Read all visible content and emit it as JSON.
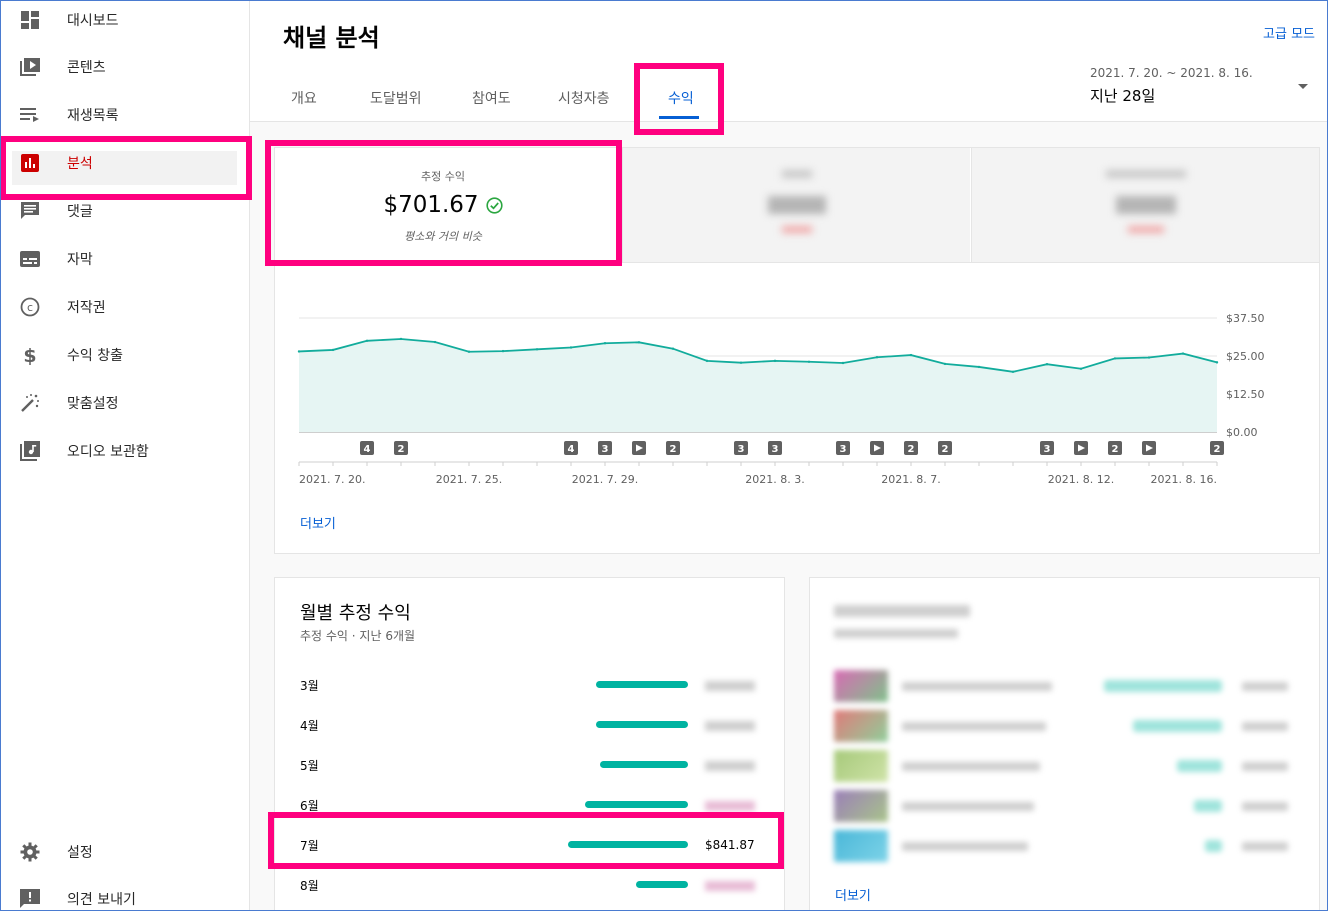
{
  "sidebar": {
    "items": [
      {
        "label": "대시보드",
        "icon": "dashboard-icon"
      },
      {
        "label": "콘텐츠",
        "icon": "content-icon"
      },
      {
        "label": "재생목록",
        "icon": "playlist-icon"
      },
      {
        "label": "분석",
        "icon": "analytics-icon"
      },
      {
        "label": "댓글",
        "icon": "comments-icon"
      },
      {
        "label": "자막",
        "icon": "subtitles-icon"
      },
      {
        "label": "저작권",
        "icon": "copyright-icon"
      },
      {
        "label": "수익 창출",
        "icon": "monetization-icon"
      },
      {
        "label": "맞춤설정",
        "icon": "customization-icon"
      },
      {
        "label": "오디오 보관함",
        "icon": "audio-library-icon"
      }
    ],
    "bottom": [
      {
        "label": "설정",
        "icon": "gear-icon"
      },
      {
        "label": "의견 보내기",
        "icon": "feedback-icon"
      }
    ]
  },
  "header": {
    "title": "채널 분석",
    "advanced_mode": "고급 모드",
    "tabs": [
      {
        "label": "개요"
      },
      {
        "label": "도달범위"
      },
      {
        "label": "참여도"
      },
      {
        "label": "시청자층"
      },
      {
        "label": "수익"
      }
    ],
    "active_tab": "수익",
    "date_range": "2021. 7. 20. ~ 2021. 8. 16.",
    "date_preset": "지난 28일"
  },
  "metric": {
    "label": "추정 수익",
    "value": "$701.67",
    "comparison": "평소와 거의 비슷"
  },
  "chart_data": {
    "type": "area",
    "x": [
      "2021. 7. 20.",
      "2021. 7. 21.",
      "2021. 7. 22.",
      "2021. 7. 23.",
      "2021. 7. 24.",
      "2021. 7. 25.",
      "2021. 7. 26.",
      "2021. 7. 27.",
      "2021. 7. 28.",
      "2021. 7. 29.",
      "2021. 7. 30.",
      "2021. 7. 31.",
      "2021. 8. 1.",
      "2021. 8. 2.",
      "2021. 8. 3.",
      "2021. 8. 4.",
      "2021. 8. 5.",
      "2021. 8. 6.",
      "2021. 8. 7.",
      "2021. 8. 8.",
      "2021. 8. 9.",
      "2021. 8. 10.",
      "2021. 8. 11.",
      "2021. 8. 12.",
      "2021. 8. 13.",
      "2021. 8. 14.",
      "2021. 8. 15.",
      "2021. 8. 16."
    ],
    "series": [
      {
        "values": [
          26.5,
          27.0,
          30.0,
          30.6,
          29.6,
          26.4,
          26.6,
          27.2,
          27.8,
          29.2,
          29.5,
          27.4,
          23.4,
          22.8,
          23.4,
          23.1,
          22.7,
          24.6,
          25.3,
          22.4,
          21.4,
          19.8,
          22.3,
          20.8,
          24.2,
          24.5,
          25.8,
          22.9
        ]
      }
    ],
    "y_ticks": [
      "$37.50",
      "$25.00",
      "$12.50",
      "$0.00"
    ],
    "ylim": [
      0,
      37.5
    ],
    "x_tick_labels": [
      {
        "i": 0,
        "label": "2021. 7. 20."
      },
      {
        "i": 5,
        "label": "2021. 7. 25."
      },
      {
        "i": 9,
        "label": "2021. 7. 29."
      },
      {
        "i": 14,
        "label": "2021. 8. 3."
      },
      {
        "i": 18,
        "label": "2021. 8. 7."
      },
      {
        "i": 23,
        "label": "2021. 8. 12."
      },
      {
        "i": 27,
        "label": "2021. 8. 16."
      }
    ],
    "markers": [
      {
        "i": 2,
        "text": "4"
      },
      {
        "i": 3,
        "text": "2"
      },
      {
        "i": 8,
        "text": "4"
      },
      {
        "i": 9,
        "text": "3"
      },
      {
        "i": 10,
        "text": "▶"
      },
      {
        "i": 11,
        "text": "2"
      },
      {
        "i": 13,
        "text": "3"
      },
      {
        "i": 14,
        "text": "3"
      },
      {
        "i": 16,
        "text": "3"
      },
      {
        "i": 17,
        "text": "▶"
      },
      {
        "i": 18,
        "text": "2"
      },
      {
        "i": 19,
        "text": "2"
      },
      {
        "i": 22,
        "text": "3"
      },
      {
        "i": 23,
        "text": "▶"
      },
      {
        "i": 24,
        "text": "2"
      },
      {
        "i": 25,
        "text": "▶"
      },
      {
        "i": 27,
        "text": "2"
      }
    ],
    "grid": true,
    "colors": {
      "line": "#12ac9c",
      "fill": "#e6f5f3"
    }
  },
  "chart_more": "더보기",
  "monthly": {
    "title": "월별 추정 수익",
    "subtitle": "추정 수익 · 지난 6개월",
    "rows": [
      {
        "label": "3월",
        "value_fraction": 0.77
      },
      {
        "label": "4월",
        "value_fraction": 0.77
      },
      {
        "label": "5월",
        "value_fraction": 0.73
      },
      {
        "label": "6월",
        "value_fraction": 0.86
      },
      {
        "label": "7월",
        "value": "$841.87",
        "value_fraction": 1.0
      },
      {
        "label": "8월",
        "value_fraction": 0.43
      }
    ]
  },
  "right_card": {
    "more": "더보기",
    "bar_fractions": [
      1.0,
      0.75,
      0.38,
      0.24,
      0.14
    ]
  }
}
